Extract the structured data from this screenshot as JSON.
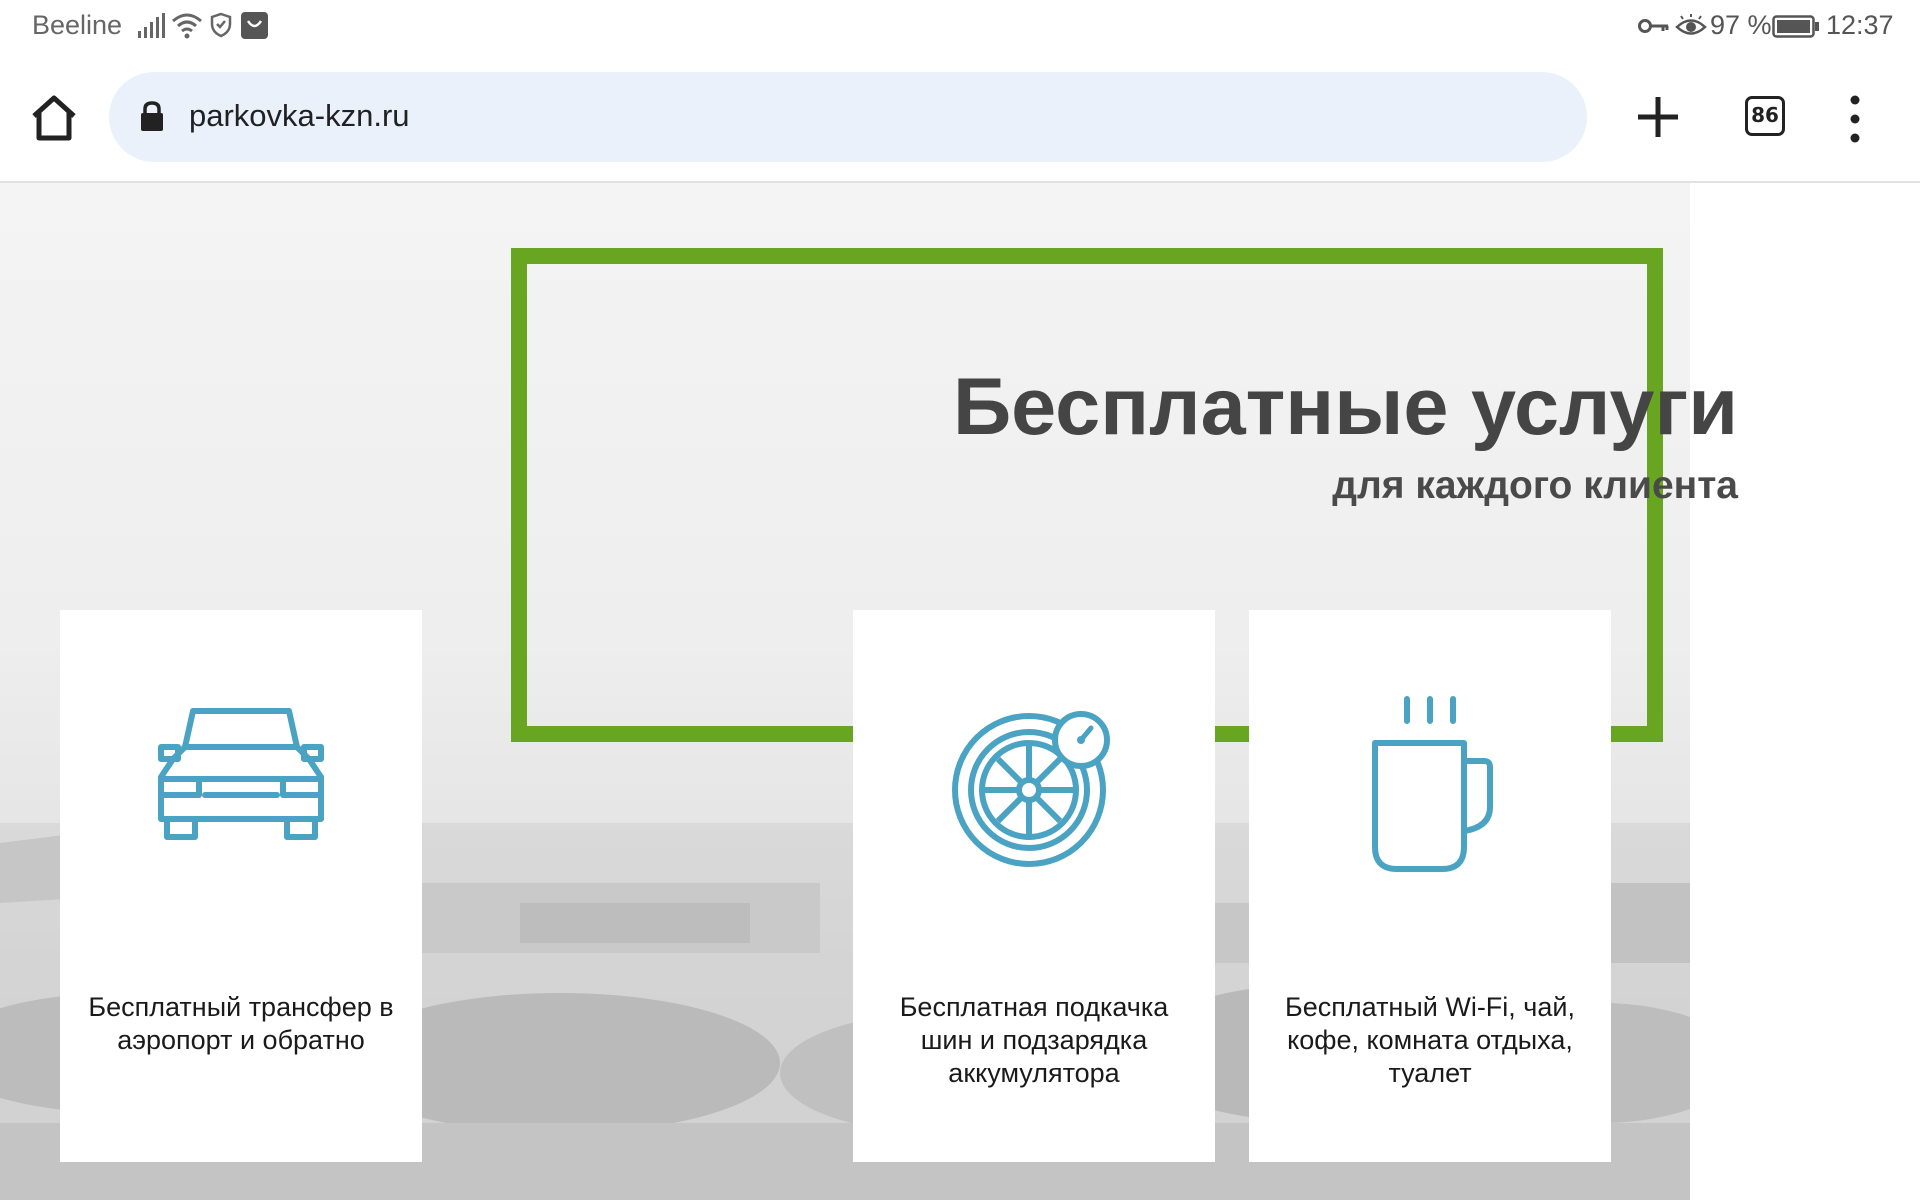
{
  "status_bar": {
    "carrier": "Beeline",
    "battery": "97 %",
    "time": "12:37",
    "icons": [
      "signal-icon",
      "wifi-icon",
      "shield-icon",
      "app-notification-icon",
      "key-icon",
      "eye-icon",
      "battery-icon"
    ]
  },
  "browser": {
    "url": "parkovka-kzn.ru",
    "tab_count": "86",
    "icons": [
      "home-icon",
      "lock-icon",
      "plus-icon",
      "tabs-icon",
      "more-vert-icon"
    ]
  },
  "hero": {
    "title": "Бесплатные услуги",
    "subtitle": "для каждого клиента",
    "frame_color": "#68a621"
  },
  "services": [
    {
      "icon": "car-icon",
      "text": "Бесплатный трансфер в аэропорт и обратно"
    },
    {
      "icon": "tire-pressure-icon",
      "text": "Бесплатная подкачка шин и подзарядка аккумулятора"
    },
    {
      "icon": "coffee-mug-icon",
      "text": "Бесплатный Wi-Fi, чай, кофе, комната отдыха, туалет"
    }
  ],
  "colors": {
    "accent_green": "#68a621",
    "icon_blue": "#4ba3c3",
    "url_bar_bg": "#ebf1fa"
  }
}
